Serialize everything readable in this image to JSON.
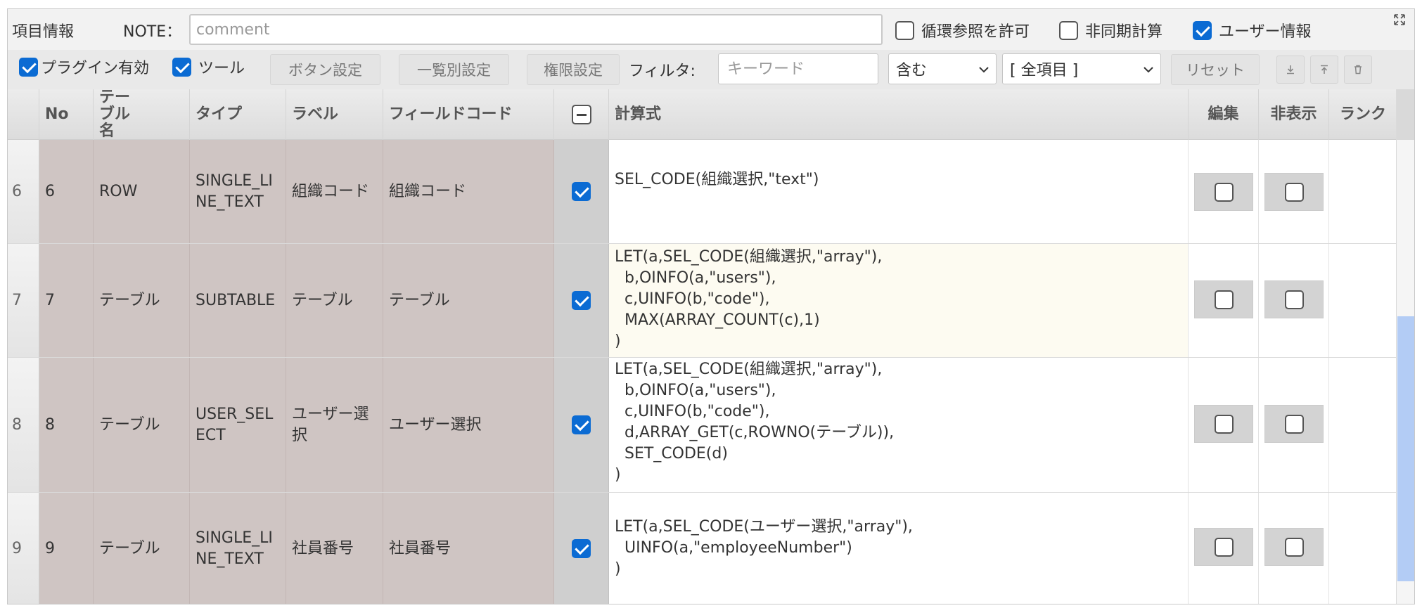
{
  "header": {
    "title": "項目情報",
    "note_label": "NOTE：",
    "note_placeholder": "comment",
    "options": [
      {
        "label": "循環参照を許可",
        "checked": false
      },
      {
        "label": "非同期計算",
        "checked": false
      },
      {
        "label": "ユーザー情報",
        "checked": true
      }
    ]
  },
  "toolbar": {
    "plugin_enabled": {
      "label": "プラグイン有効",
      "checked": true
    },
    "tool": {
      "label": "ツール",
      "checked": true
    },
    "button_settings": "ボタン設定",
    "list_settings": "一覧別設定",
    "permission_settings": "権限設定",
    "filter_label": "フィルタ:",
    "filter_placeholder": "キーワード",
    "match_select": "含む",
    "scope_select": "[ 全項目 ]",
    "reset": "リセット",
    "icons": [
      "download-icon",
      "upload-icon",
      "trash-icon"
    ]
  },
  "table": {
    "columns": [
      "No",
      "テーブル名",
      "タイプ",
      "ラベル",
      "フィールドコード",
      "",
      "計算式",
      "編集",
      "非表示",
      "ランク"
    ],
    "rows": [
      {
        "index": "6",
        "no": "6",
        "table": "ROW",
        "type": "SINGLE_LINE_TEXT",
        "label": "組織コード",
        "field_code": "組織コード",
        "checked": true,
        "formula": "SEL_CODE(組織選択,\"text\")",
        "edit": false,
        "hidden": false,
        "rank": ""
      },
      {
        "index": "7",
        "no": "7",
        "table": "テーブル",
        "type": "SUBTABLE",
        "label": "テーブル",
        "field_code": "テーブル",
        "checked": true,
        "formula": "LET(a,SEL_CODE(組織選択,\"array\"),\n  b,OINFO(a,\"users\"),\n  c,UINFO(b,\"code\"),\n  MAX(ARRAY_COUNT(c),1)\n)",
        "edit": false,
        "hidden": false,
        "rank": ""
      },
      {
        "index": "8",
        "no": "8",
        "table": "テーブル",
        "type": "USER_SELECT",
        "label": "ユーザー選択",
        "field_code": "ユーザー選択",
        "checked": true,
        "formula": "LET(a,SEL_CODE(組織選択,\"array\"),\n  b,OINFO(a,\"users\"),\n  c,UINFO(b,\"code\"),\n  d,ARRAY_GET(c,ROWNO(テーブル)),\n  SET_CODE(d)\n)",
        "edit": false,
        "hidden": false,
        "rank": ""
      },
      {
        "index": "9",
        "no": "9",
        "table": "テーブル",
        "type": "SINGLE_LINE_TEXT",
        "label": "社員番号",
        "field_code": "社員番号",
        "checked": true,
        "formula": "LET(a,SEL_CODE(ユーザー選択,\"array\"),\n  UINFO(a,\"employeeNumber\")\n)",
        "edit": false,
        "hidden": false,
        "rank": ""
      }
    ]
  }
}
